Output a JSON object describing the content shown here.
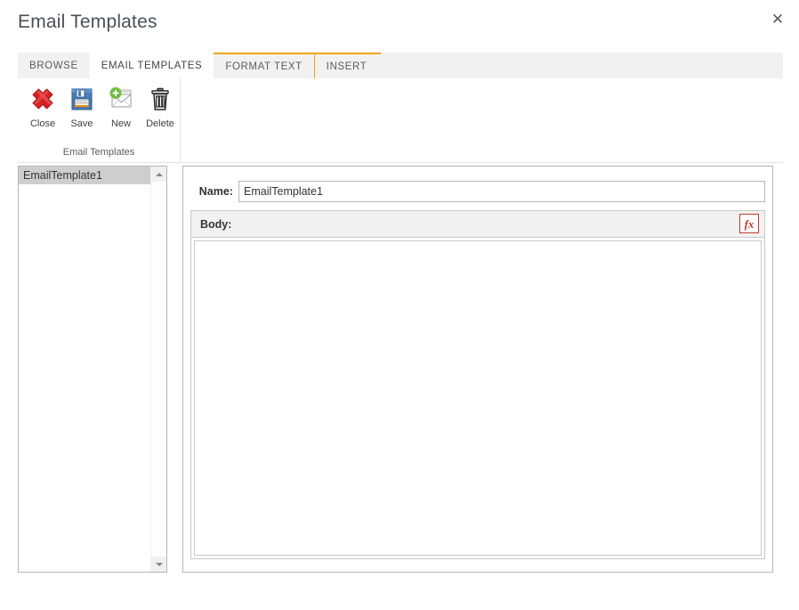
{
  "dialog": {
    "title": "Email Templates",
    "close_icon": "close-icon",
    "close_glyph": "✕"
  },
  "ribbon": {
    "tabs": [
      {
        "label": "BROWSE",
        "active": false,
        "contextual": false
      },
      {
        "label": "EMAIL TEMPLATES",
        "active": true,
        "contextual": false
      },
      {
        "label": "FORMAT TEXT",
        "active": false,
        "contextual": true
      },
      {
        "label": "INSERT",
        "active": false,
        "contextual": true
      }
    ],
    "contextual_accent": "#f0a30a",
    "group": {
      "title": "Email Templates",
      "buttons": [
        {
          "label": "Close",
          "icon": "red-x-icon"
        },
        {
          "label": "Save",
          "icon": "floppy-disk-icon"
        },
        {
          "label": "New",
          "icon": "new-envelope-icon"
        },
        {
          "label": "Delete",
          "icon": "trash-can-icon"
        }
      ]
    }
  },
  "list": {
    "items": [
      {
        "label": "EmailTemplate1",
        "selected": true
      }
    ],
    "scrollbar": {
      "up_arrow": "chevron-up-icon",
      "down_arrow": "chevron-down-icon"
    }
  },
  "form": {
    "name_label": "Name:",
    "name_value": "EmailTemplate1",
    "name_placeholder": "",
    "body_label": "Body:",
    "body_value": "",
    "body_placeholder": "",
    "fx_label": "fx",
    "fx_icon": "formula-icon",
    "fx_color": "#c0392b"
  }
}
